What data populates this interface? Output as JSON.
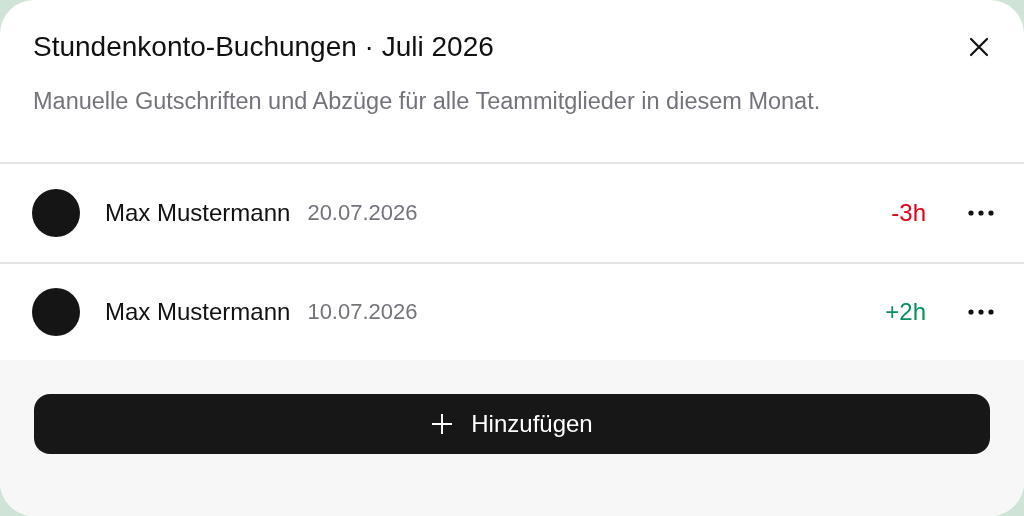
{
  "dialog": {
    "title": "Stundenkonto-Buchungen · Juli 2026",
    "description": "Manuelle Gutschriften und Abzüge für alle Teammitglieder in diesem Monat."
  },
  "entries": [
    {
      "name": "Max Mustermann",
      "date": "20.07.2026",
      "amount": "-3h",
      "kind": "debit"
    },
    {
      "name": "Max Mustermann",
      "date": "10.07.2026",
      "amount": "+2h",
      "kind": "credit"
    }
  ],
  "add_button": {
    "label": "Hinzufügen"
  }
}
